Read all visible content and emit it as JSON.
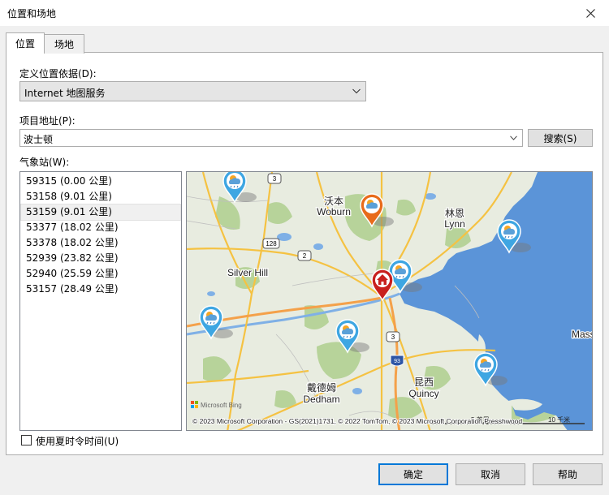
{
  "window": {
    "title": "位置和场地"
  },
  "tabs": [
    {
      "label": "位置",
      "active": true
    },
    {
      "label": "场地",
      "active": false
    }
  ],
  "location": {
    "define_label": "定义位置依据(D):",
    "define_value": "Internet 地图服务",
    "address_label": "项目地址(P):",
    "address_value": "波士顿",
    "search_label": "搜索(S)"
  },
  "stations": {
    "label": "气象站(W):",
    "items": [
      {
        "label": "59315 (0.00 公里)"
      },
      {
        "label": "53158 (9.01 公里)"
      },
      {
        "label": "53159 (9.01 公里)",
        "selected": true
      },
      {
        "label": "53377 (18.02 公里)"
      },
      {
        "label": "53378 (18.02 公里)"
      },
      {
        "label": "52939 (23.82 公里)"
      },
      {
        "label": "52940 (25.59 公里)"
      },
      {
        "label": "53157 (28.49 公里)"
      }
    ]
  },
  "map": {
    "places": {
      "woburn_cn": "沃本",
      "woburn": "Woburn",
      "lynn_cn": "林恩",
      "lynn": "Lynn",
      "silver_hill": "Silver Hill",
      "dedham_cn": "戴德姆",
      "dedham": "Dedham",
      "quincy_cn": "昆西",
      "quincy": "Quincy",
      "mass": "Mass"
    },
    "road_shields": {
      "r3_top": "3",
      "r128": "128",
      "r2": "2",
      "r3_bottom": "3",
      "r93": "93"
    },
    "attribution": "© 2023 Microsoft Corporation - GS(2021)1731, © 2022 TomTom, © 2023 Microsoft Corporation Presshwood",
    "logo": "Microsoft Bing",
    "scale_miles": "5 英里",
    "scale_km": "10 千米",
    "colors": {
      "land": "#e8ece0",
      "water": "#5b94d8",
      "green": "#b7d39a",
      "road": "#f5c242",
      "highway": "#f4a14a",
      "station_pin": "#3ea6e2",
      "woburn_pin": "#e86b1a",
      "home_pin": "#c8201e"
    }
  },
  "dst": {
    "label": "使用夏时令时间(U)"
  },
  "buttons": {
    "ok": "确定",
    "cancel": "取消",
    "help": "帮助"
  }
}
